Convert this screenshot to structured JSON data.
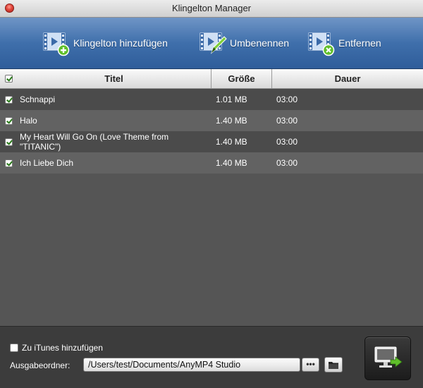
{
  "window": {
    "title": "Klingelton Manager"
  },
  "toolbar": {
    "add_label": "Klingelton hinzufügen",
    "rename_label": "Umbenennen",
    "remove_label": "Entfernen"
  },
  "table": {
    "headers": {
      "title": "Titel",
      "size": "Größe",
      "duration": "Dauer"
    },
    "select_all_checked": true,
    "rows": [
      {
        "checked": true,
        "title": "Schnappi",
        "size": "1.01 MB",
        "duration": "03:00"
      },
      {
        "checked": true,
        "title": "Halo",
        "size": "1.40 MB",
        "duration": "03:00"
      },
      {
        "checked": true,
        "title": "My Heart Will Go On (Love Theme from \"TITANIC\")",
        "size": "1.40 MB",
        "duration": "03:00"
      },
      {
        "checked": true,
        "title": "Ich Liebe Dich",
        "size": "1.40 MB",
        "duration": "03:00"
      }
    ]
  },
  "bottom": {
    "itunes_label": "Zu iTunes hinzufügen",
    "itunes_checked": false,
    "output_label": "Ausgabeordner:",
    "output_path": "/Users/test/Documents/AnyMP4 Studio",
    "browse_label": "•••"
  },
  "colors": {
    "toolbar_top": "#6f95c6",
    "toolbar_bottom": "#2f5d9a",
    "row_odd": "#4b4b4b",
    "row_even": "#626262",
    "check_green": "#2a7a1a",
    "icon_badge_green": "#5fbf2a"
  },
  "icons": {
    "add": "film-add-icon",
    "rename": "film-edit-icon",
    "remove": "film-remove-icon",
    "close": "close-icon",
    "folder": "folder-icon",
    "export": "export-to-device-icon"
  }
}
